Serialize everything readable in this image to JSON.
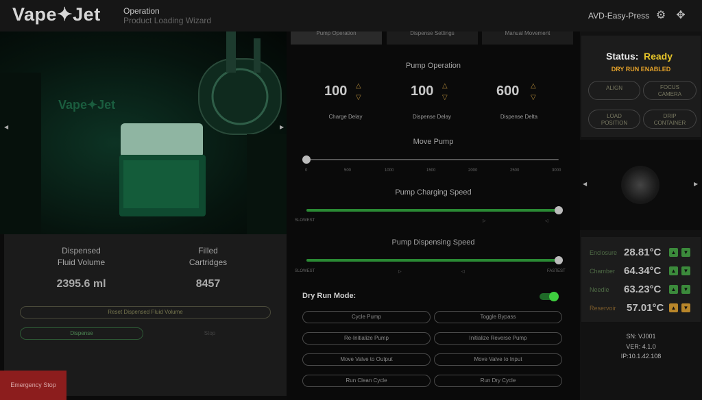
{
  "header": {
    "logo": "Vape✦Jet",
    "nav_title": "Operation",
    "nav_sub": "Product Loading Wizard",
    "device": "AVD-Easy-Press"
  },
  "camera": {
    "overlay_text": "Vape✦Jet"
  },
  "stats": {
    "fluid_label1": "Dispensed",
    "fluid_label2": "Fluid Volume",
    "fluid_value": "2395.6 ml",
    "cart_label1": "Filled",
    "cart_label2": "Cartridges",
    "cart_value": "8457",
    "reset_label": "Reset Dispensed Fluid Volume",
    "dispense_label": "Dispense",
    "stop_label": "Stop"
  },
  "estop_label": "Emergency Stop",
  "tabs": [
    "Pump Operation",
    "Dispense Settings",
    "Manual Movement"
  ],
  "pump_op": {
    "title": "Pump Operation",
    "charge_delay": "100",
    "charge_label": "Charge Delay",
    "dispense_delay": "100",
    "dispense_label": "Dispense Delay",
    "dispense_delta": "600",
    "delta_label": "Dispense Delta"
  },
  "move_pump": {
    "title": "Move Pump",
    "ticks": [
      "0",
      "500",
      "1000",
      "1500",
      "2000",
      "2500",
      "3000"
    ],
    "value": 0,
    "max": 3000
  },
  "charging": {
    "title": "Pump Charging Speed",
    "left": "SLOWEST",
    "level": 1.0
  },
  "dispensing": {
    "title": "Pump Dispensing Speed",
    "left": "SLOWEST",
    "right": "FASTEST",
    "level": 1.0
  },
  "dry_run": {
    "label": "Dry Run Mode:",
    "enabled": true
  },
  "buttons": [
    "Cycle Pump",
    "Toggle Bypass",
    "Re-Initialize Pump",
    "Initialize Reverse Pump",
    "Move Valve to Output",
    "Move Valve to Input",
    "Run Clean Cycle",
    "Run Dry Cycle"
  ],
  "status": {
    "prefix": "Status:",
    "value": "Ready",
    "dry": "DRY RUN ENABLED"
  },
  "ops": {
    "align": "ALIGN",
    "focus1": "FOCUS",
    "focus2": "CAMERA",
    "load1": "LOAD",
    "load2": "POSITION",
    "drip1": "DRIP",
    "drip2": "CONTAINER"
  },
  "temps": [
    {
      "name": "Enclosure",
      "value": "28.81°C"
    },
    {
      "name": "Chamber",
      "value": "64.34°C"
    },
    {
      "name": "Needle",
      "value": "63.23°C"
    },
    {
      "name": "Reservoir",
      "value": "57.01°C"
    }
  ],
  "info": {
    "sn": "SN: VJ001",
    "ver": "VER: 4.1.0",
    "ip": "IP:10.1.42.108"
  },
  "colors": {
    "accent_green": "#2fae3a",
    "status_yellow": "#e6c52a",
    "estop_red": "#8c1d1d"
  }
}
